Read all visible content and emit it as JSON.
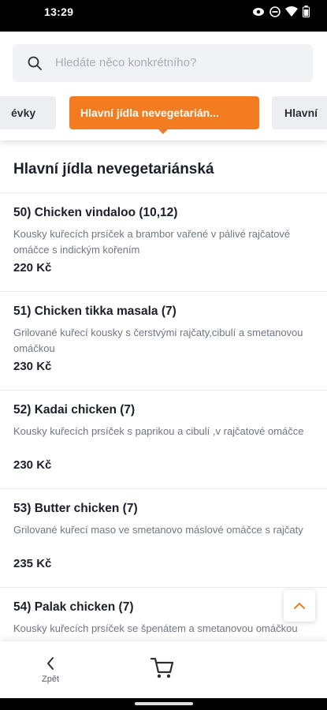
{
  "status_bar": {
    "time": "13:29"
  },
  "search": {
    "placeholder": "Hledáte něco konkrétního?"
  },
  "tabs": {
    "prev_label": "évky",
    "active_label": "Hlavní jídla nevegetarián...",
    "next_label": "Hlavní"
  },
  "section": {
    "title": "Hlavní jídla nevegetariánská"
  },
  "items": [
    {
      "name": "50) Chicken vindaloo (10,12)",
      "description": "Kousky kuřecích prsíček a brambor vařené v pálivé rajčatové omáčce s indickým kořením",
      "price": "220 Kč"
    },
    {
      "name": "51) Chicken tikka masala (7)",
      "description": "Grilované kuřecí kousky s čerstvými rajčaty,cibulí a smetanovou omáčkou",
      "price": "230 Kč"
    },
    {
      "name": "52) Kadai chicken (7)",
      "description": "Kousky kuřecích prsíček s paprikou a cibulí ,v rajčatové omáčce",
      "price": "230 Kč"
    },
    {
      "name": "53) Butter chicken (7)",
      "description": "Grilované kuřecí maso ve smetanovo máslové omáčce s rajčaty",
      "price": "235 Kč"
    },
    {
      "name": "54) Palak chicken (7)",
      "description": "Kousky kuřecích prsíček se špenátem a smetanovou omáčkou",
      "price": ""
    }
  ],
  "bottom_nav": {
    "back_label": "Zpět"
  },
  "icons": {
    "search": "search-icon",
    "back": "chevron-left-icon",
    "cart": "cart-icon",
    "scroll_top": "chevron-up-icon",
    "eye": "eye-icon",
    "dnd": "do-not-disturb-icon",
    "wifi": "wifi-icon",
    "battery": "battery-icon"
  },
  "colors": {
    "accent": "#f47c20",
    "text": "#1b1f29",
    "muted": "#6f7682",
    "search_bg": "#f0f2f5"
  }
}
